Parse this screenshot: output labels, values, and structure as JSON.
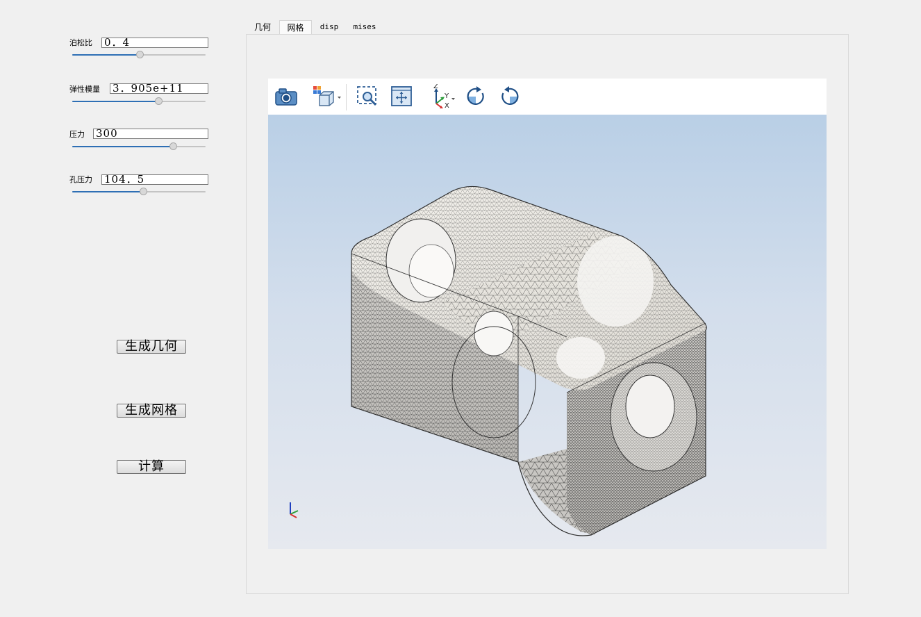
{
  "params": [
    {
      "label": "泊松比",
      "value": "0．4",
      "slider": 0.5
    },
    {
      "label": "弹性模量",
      "value": "3．905e+11",
      "slider": 0.65
    },
    {
      "label": "压力",
      "value": "300",
      "slider": 0.75
    },
    {
      "label": "孔压力",
      "value": "104．5",
      "slider": 0.53
    }
  ],
  "buttons": {
    "gen_geometry": "生成几何",
    "gen_mesh": "生成网格",
    "compute": "计算"
  },
  "tabs": [
    {
      "label": "几何",
      "active": false
    },
    {
      "label": "网格",
      "active": true
    },
    {
      "label": "disp",
      "active": false
    },
    {
      "label": "mises",
      "active": false
    }
  ],
  "toolbar": {
    "icons": [
      "camera-icon",
      "view-cube-icon",
      "zoom-box-icon",
      "fit-all-icon",
      "axes-orientation-icon",
      "rotate-cw-icon",
      "rotate-ccw-icon"
    ],
    "axis_letters": {
      "x": "X",
      "y": "Y",
      "z": "Z"
    }
  },
  "colors": {
    "slider_fill": "#2e6fb5",
    "viewport_top": "#b9cfe6",
    "viewport_bottom": "#e6e9ef",
    "mesh_line": "#3a3a3a",
    "mesh_face": "#efece6"
  }
}
